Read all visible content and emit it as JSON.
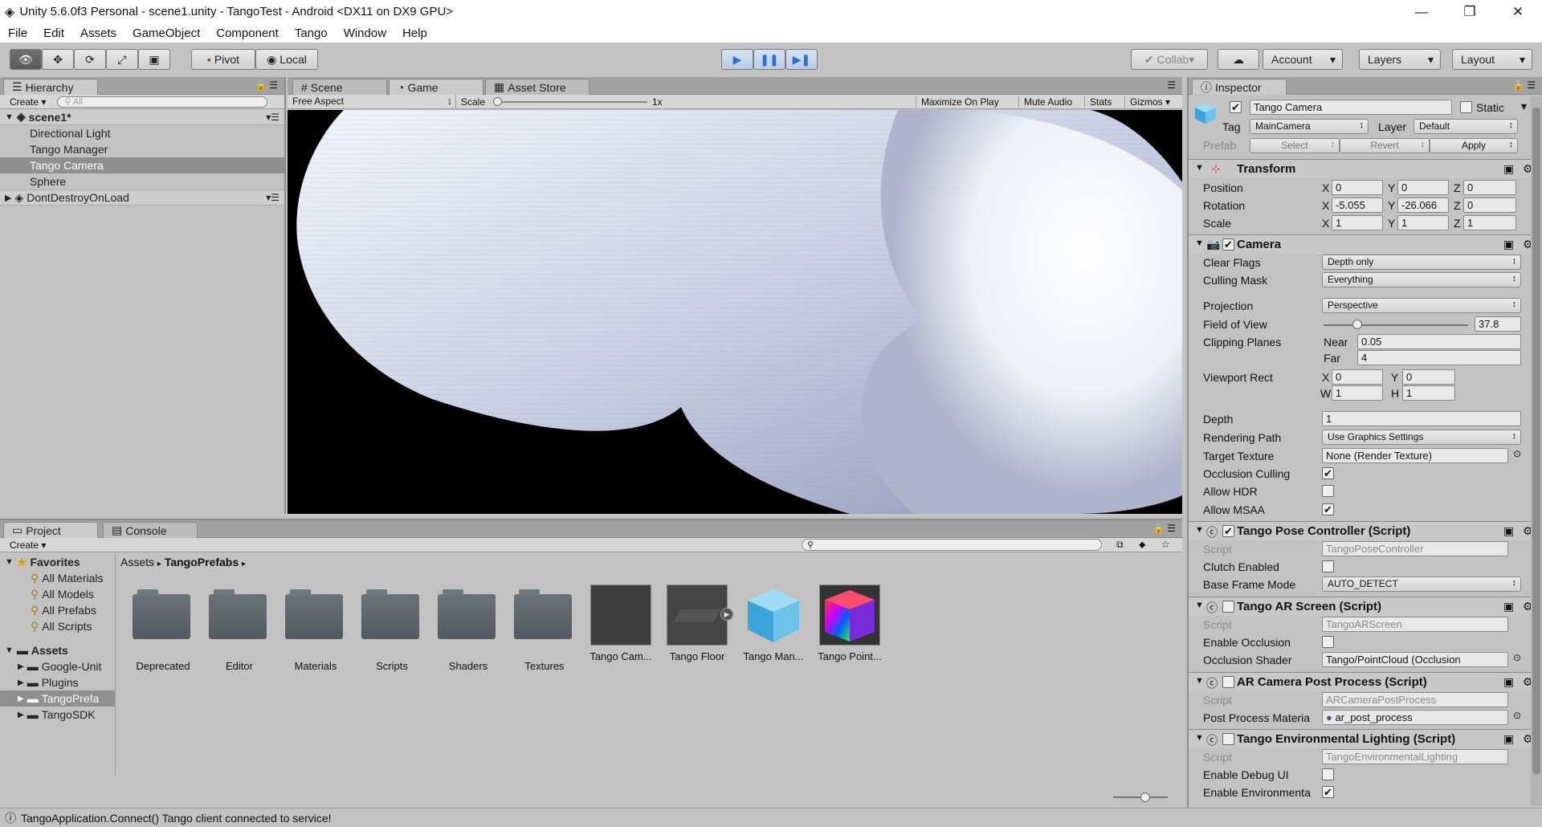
{
  "window": {
    "title": "Unity 5.6.0f3 Personal - scene1.unity - TangoTest - Android <DX11 on DX9 GPU>"
  },
  "menu": [
    "File",
    "Edit",
    "Assets",
    "GameObject",
    "Component",
    "Tango",
    "Window",
    "Help"
  ],
  "toolbar": {
    "pivot": "Pivot",
    "local": "Local",
    "collab": "Collab",
    "account": "Account",
    "layers": "Layers",
    "layout": "Layout"
  },
  "hierarchy": {
    "tab": "Hierarchy",
    "create": "Create",
    "search_placeholder": "All",
    "scene": "scene1*",
    "items": [
      "Directional Light",
      "Tango Manager",
      "Tango Camera",
      "Sphere"
    ],
    "dontdestroy": "DontDestroyOnLoad"
  },
  "game_view": {
    "tabs": [
      "Scene",
      "Game",
      "Asset Store"
    ],
    "aspect": "Free Aspect",
    "scale_label": "Scale",
    "scale_value": "1x",
    "buttons": [
      "Maximize On Play",
      "Mute Audio",
      "Stats",
      "Gizmos"
    ]
  },
  "project": {
    "tabs": [
      "Project",
      "Console"
    ],
    "create": "Create",
    "favorites_label": "Favorites",
    "favorites": [
      "All Materials",
      "All Models",
      "All Prefabs",
      "All Scripts"
    ],
    "assets_label": "Assets",
    "asset_folders": [
      "Google-Unit",
      "Plugins",
      "TangoPrefa",
      "TangoSDK"
    ],
    "breadcrumb": [
      "Assets",
      "TangoPrefabs"
    ],
    "items": [
      "Deprecated",
      "Editor",
      "Materials",
      "Scripts",
      "Shaders",
      "Textures",
      "Tango Cam...",
      "Tango Floor",
      "Tango Man...",
      "Tango Point..."
    ]
  },
  "inspector": {
    "tab": "Inspector",
    "object_name": "Tango Camera",
    "static": "Static",
    "tag_label": "Tag",
    "tag": "MainCamera",
    "layer_label": "Layer",
    "layer": "Default",
    "prefab": "Prefab",
    "select": "Select",
    "revert": "Revert",
    "apply": "Apply",
    "transform": {
      "title": "Transform",
      "position": "Position",
      "rotation": "Rotation",
      "scale": "Scale",
      "pos": [
        "0",
        "0",
        "0"
      ],
      "rot": [
        "-5.055",
        "-26.066",
        "0"
      ],
      "scl": [
        "1",
        "1",
        "1"
      ]
    },
    "camera": {
      "title": "Camera",
      "clear_flags": "Clear Flags",
      "clear_flags_v": "Depth only",
      "culling_mask": "Culling Mask",
      "culling_mask_v": "Everything",
      "projection": "Projection",
      "projection_v": "Perspective",
      "fov": "Field of View",
      "fov_v": "37.8",
      "clipping": "Clipping Planes",
      "near": "Near",
      "near_v": "0.05",
      "far": "Far",
      "far_v": "4",
      "viewport": "Viewport Rect",
      "vx": "0",
      "vy": "0",
      "vw": "1",
      "vh": "1",
      "depth": "Depth",
      "depth_v": "1",
      "rendering_path": "Rendering Path",
      "rendering_path_v": "Use Graphics Settings",
      "target_texture": "Target Texture",
      "target_texture_v": "None (Render Texture)",
      "occlusion": "Occlusion Culling",
      "hdr": "Allow HDR",
      "msaa": "Allow MSAA"
    },
    "pose": {
      "title": "Tango Pose Controller (Script)",
      "script": "Script",
      "script_v": "TangoPoseController",
      "clutch": "Clutch Enabled",
      "base_frame": "Base Frame Mode",
      "base_frame_v": "AUTO_DETECT"
    },
    "arscreen": {
      "title": "Tango AR Screen (Script)",
      "script": "Script",
      "script_v": "TangoARScreen",
      "enable_occ": "Enable Occlusion",
      "occ_shader": "Occlusion Shader",
      "occ_shader_v": "Tango/PointCloud (Occlusion"
    },
    "arpost": {
      "title": "AR Camera Post Process (Script)",
      "script": "Script",
      "script_v": "ARCameraPostProcess",
      "mat": "Post Process Materia",
      "mat_v": "ar_post_process"
    },
    "envlight": {
      "title": "Tango Environmental Lighting (Script)",
      "script": "Script",
      "script_v": "TangoEnvironmentalLighting",
      "debug": "Enable Debug UI",
      "env": "Enable Environmenta"
    }
  },
  "status": {
    "message": "TangoApplication.Connect() Tango client connected to service!"
  }
}
